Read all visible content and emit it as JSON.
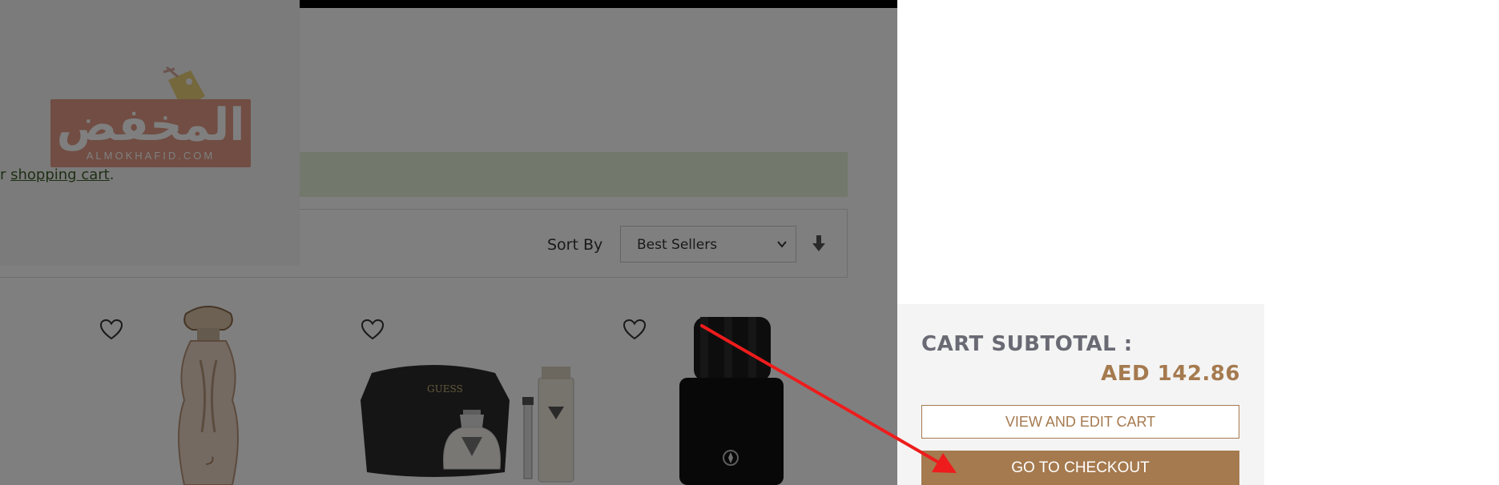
{
  "brand": {
    "logo_arabic": "المخفض",
    "logo_latin": "ALMOKHAFID.COM"
  },
  "message": {
    "prefix": "r ",
    "link_text": "shopping cart",
    "suffix": "."
  },
  "toolbar": {
    "sort_label": "Sort By",
    "sort_value": "Best Sellers"
  },
  "products": [
    {
      "name": "perfume-bottle-gold"
    },
    {
      "name": "guess-gift-set",
      "brand": "GUESS"
    },
    {
      "name": "montblanc-explorer-black"
    }
  ],
  "minicart": {
    "subtotal_label": "CART SUBTOTAL :",
    "subtotal_value": "AED 142.86",
    "view_edit_label": "VIEW AND EDIT CART",
    "checkout_label": "GO TO CHECKOUT"
  },
  "colors": {
    "accent": "#a57a4f",
    "overlay": "rgba(0,0,0,0.5)",
    "message_bg": "#e5f0d9"
  },
  "annotation": {
    "arrow_color": "#ee1c1c"
  }
}
